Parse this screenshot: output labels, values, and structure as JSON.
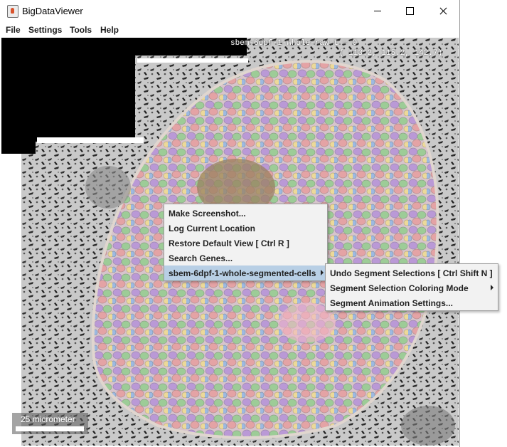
{
  "window": {
    "title": "BigDataViewer"
  },
  "icons": {
    "app": "bigdataviewer-app-icon",
    "minimize": "minimize-icon",
    "maximize": "maximize-icon",
    "close": "close-icon",
    "submenu": "submenu-arrow-icon"
  },
  "menu": {
    "file": "File",
    "settings": "Settings",
    "tools": "Tools",
    "help": "Help"
  },
  "viewer": {
    "source_label": "sbem-6dpf-1-whole-raw t = 0",
    "coordinates": "( 113.2, 115.2, 142.7)",
    "scale_bar_label": "25 micrometer"
  },
  "context_menu": {
    "items": [
      "Make Screenshot...",
      "Log Current Location",
      "Restore Default View [ Ctrl R ]",
      "Search Genes...",
      "sbem-6dpf-1-whole-segmented-cells"
    ],
    "active_index": 4
  },
  "submenu": {
    "items": [
      "Undo Segment Selections [ Ctrl Shift N ]",
      "Segment Selection Coloring Mode",
      "Segment Animation Settings..."
    ]
  },
  "colors": {
    "menu_highlight": "#b8cfe5",
    "menu_background": "#f2f2f2",
    "viewer_background": "#000000"
  }
}
